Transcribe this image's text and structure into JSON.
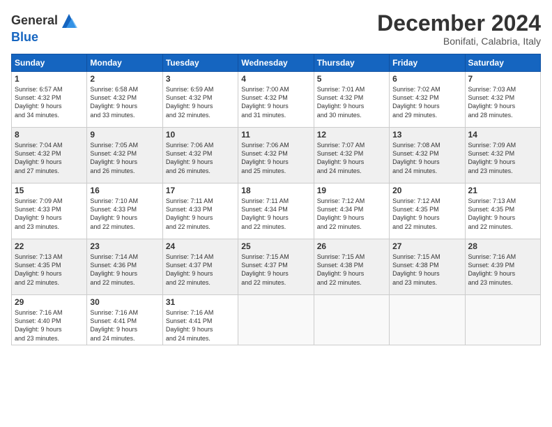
{
  "header": {
    "logo_line1": "General",
    "logo_line2": "Blue",
    "month": "December 2024",
    "location": "Bonifati, Calabria, Italy"
  },
  "weekdays": [
    "Sunday",
    "Monday",
    "Tuesday",
    "Wednesday",
    "Thursday",
    "Friday",
    "Saturday"
  ],
  "weeks": [
    [
      {
        "day": "1",
        "info": "Sunrise: 6:57 AM\nSunset: 4:32 PM\nDaylight: 9 hours\nand 34 minutes."
      },
      {
        "day": "2",
        "info": "Sunrise: 6:58 AM\nSunset: 4:32 PM\nDaylight: 9 hours\nand 33 minutes."
      },
      {
        "day": "3",
        "info": "Sunrise: 6:59 AM\nSunset: 4:32 PM\nDaylight: 9 hours\nand 32 minutes."
      },
      {
        "day": "4",
        "info": "Sunrise: 7:00 AM\nSunset: 4:32 PM\nDaylight: 9 hours\nand 31 minutes."
      },
      {
        "day": "5",
        "info": "Sunrise: 7:01 AM\nSunset: 4:32 PM\nDaylight: 9 hours\nand 30 minutes."
      },
      {
        "day": "6",
        "info": "Sunrise: 7:02 AM\nSunset: 4:32 PM\nDaylight: 9 hours\nand 29 minutes."
      },
      {
        "day": "7",
        "info": "Sunrise: 7:03 AM\nSunset: 4:32 PM\nDaylight: 9 hours\nand 28 minutes."
      }
    ],
    [
      {
        "day": "8",
        "info": "Sunrise: 7:04 AM\nSunset: 4:32 PM\nDaylight: 9 hours\nand 27 minutes."
      },
      {
        "day": "9",
        "info": "Sunrise: 7:05 AM\nSunset: 4:32 PM\nDaylight: 9 hours\nand 26 minutes."
      },
      {
        "day": "10",
        "info": "Sunrise: 7:06 AM\nSunset: 4:32 PM\nDaylight: 9 hours\nand 26 minutes."
      },
      {
        "day": "11",
        "info": "Sunrise: 7:06 AM\nSunset: 4:32 PM\nDaylight: 9 hours\nand 25 minutes."
      },
      {
        "day": "12",
        "info": "Sunrise: 7:07 AM\nSunset: 4:32 PM\nDaylight: 9 hours\nand 24 minutes."
      },
      {
        "day": "13",
        "info": "Sunrise: 7:08 AM\nSunset: 4:32 PM\nDaylight: 9 hours\nand 24 minutes."
      },
      {
        "day": "14",
        "info": "Sunrise: 7:09 AM\nSunset: 4:32 PM\nDaylight: 9 hours\nand 23 minutes."
      }
    ],
    [
      {
        "day": "15",
        "info": "Sunrise: 7:09 AM\nSunset: 4:33 PM\nDaylight: 9 hours\nand 23 minutes."
      },
      {
        "day": "16",
        "info": "Sunrise: 7:10 AM\nSunset: 4:33 PM\nDaylight: 9 hours\nand 22 minutes."
      },
      {
        "day": "17",
        "info": "Sunrise: 7:11 AM\nSunset: 4:33 PM\nDaylight: 9 hours\nand 22 minutes."
      },
      {
        "day": "18",
        "info": "Sunrise: 7:11 AM\nSunset: 4:34 PM\nDaylight: 9 hours\nand 22 minutes."
      },
      {
        "day": "19",
        "info": "Sunrise: 7:12 AM\nSunset: 4:34 PM\nDaylight: 9 hours\nand 22 minutes."
      },
      {
        "day": "20",
        "info": "Sunrise: 7:12 AM\nSunset: 4:35 PM\nDaylight: 9 hours\nand 22 minutes."
      },
      {
        "day": "21",
        "info": "Sunrise: 7:13 AM\nSunset: 4:35 PM\nDaylight: 9 hours\nand 22 minutes."
      }
    ],
    [
      {
        "day": "22",
        "info": "Sunrise: 7:13 AM\nSunset: 4:35 PM\nDaylight: 9 hours\nand 22 minutes."
      },
      {
        "day": "23",
        "info": "Sunrise: 7:14 AM\nSunset: 4:36 PM\nDaylight: 9 hours\nand 22 minutes."
      },
      {
        "day": "24",
        "info": "Sunrise: 7:14 AM\nSunset: 4:37 PM\nDaylight: 9 hours\nand 22 minutes."
      },
      {
        "day": "25",
        "info": "Sunrise: 7:15 AM\nSunset: 4:37 PM\nDaylight: 9 hours\nand 22 minutes."
      },
      {
        "day": "26",
        "info": "Sunrise: 7:15 AM\nSunset: 4:38 PM\nDaylight: 9 hours\nand 22 minutes."
      },
      {
        "day": "27",
        "info": "Sunrise: 7:15 AM\nSunset: 4:38 PM\nDaylight: 9 hours\nand 23 minutes."
      },
      {
        "day": "28",
        "info": "Sunrise: 7:16 AM\nSunset: 4:39 PM\nDaylight: 9 hours\nand 23 minutes."
      }
    ],
    [
      {
        "day": "29",
        "info": "Sunrise: 7:16 AM\nSunset: 4:40 PM\nDaylight: 9 hours\nand 23 minutes."
      },
      {
        "day": "30",
        "info": "Sunrise: 7:16 AM\nSunset: 4:41 PM\nDaylight: 9 hours\nand 24 minutes."
      },
      {
        "day": "31",
        "info": "Sunrise: 7:16 AM\nSunset: 4:41 PM\nDaylight: 9 hours\nand 24 minutes."
      },
      null,
      null,
      null,
      null
    ]
  ]
}
